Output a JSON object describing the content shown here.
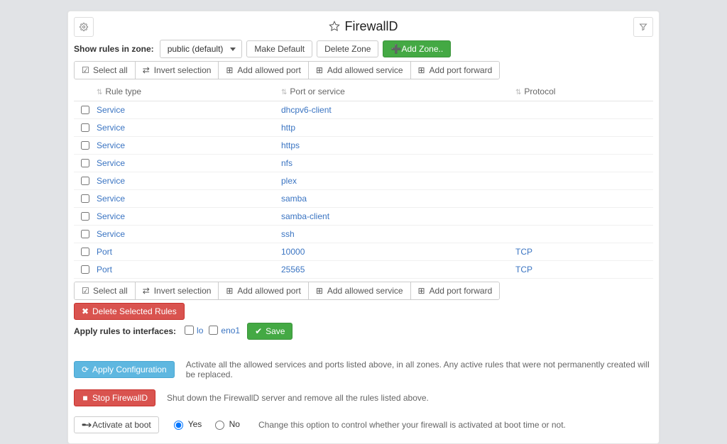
{
  "header": {
    "title": "FirewallD"
  },
  "zone": {
    "label": "Show rules in zone:",
    "selected": "public (default)",
    "make_default": "Make Default",
    "delete_zone": "Delete Zone",
    "add_zone": "Add Zone.."
  },
  "toolbar": {
    "select_all": "Select all",
    "invert": "Invert selection",
    "add_port": "Add allowed port",
    "add_service": "Add allowed service",
    "add_forward": "Add port forward"
  },
  "table": {
    "headers": {
      "rule_type": "Rule type",
      "port_or_service": "Port or service",
      "protocol": "Protocol"
    },
    "rows": [
      {
        "type": "Service",
        "port": "dhcpv6-client",
        "proto": ""
      },
      {
        "type": "Service",
        "port": "http",
        "proto": ""
      },
      {
        "type": "Service",
        "port": "https",
        "proto": ""
      },
      {
        "type": "Service",
        "port": "nfs",
        "proto": ""
      },
      {
        "type": "Service",
        "port": "plex",
        "proto": ""
      },
      {
        "type": "Service",
        "port": "samba",
        "proto": ""
      },
      {
        "type": "Service",
        "port": "samba-client",
        "proto": ""
      },
      {
        "type": "Service",
        "port": "ssh",
        "proto": ""
      },
      {
        "type": "Port",
        "port": "10000",
        "proto": "TCP"
      },
      {
        "type": "Port",
        "port": "25565",
        "proto": "TCP"
      }
    ]
  },
  "actions": {
    "delete_selected": "Delete Selected Rules"
  },
  "interfaces": {
    "label": "Apply rules to interfaces:",
    "items": [
      {
        "name": "lo",
        "checked": false
      },
      {
        "name": "eno1",
        "checked": false
      }
    ],
    "save": "Save"
  },
  "footer": {
    "apply_cfg": "Apply Configuration",
    "apply_desc": "Activate all the allowed services and ports listed above, in all zones. Any active rules that were not permanently created will be replaced.",
    "stop": "Stop FirewallD",
    "stop_desc": "Shut down the FirewallD server and remove all the rules listed above.",
    "boot_btn": "Activate at boot",
    "boot_yes": "Yes",
    "boot_no": "No",
    "boot_desc": "Change this option to control whether your firewall is activated at boot time or not."
  }
}
